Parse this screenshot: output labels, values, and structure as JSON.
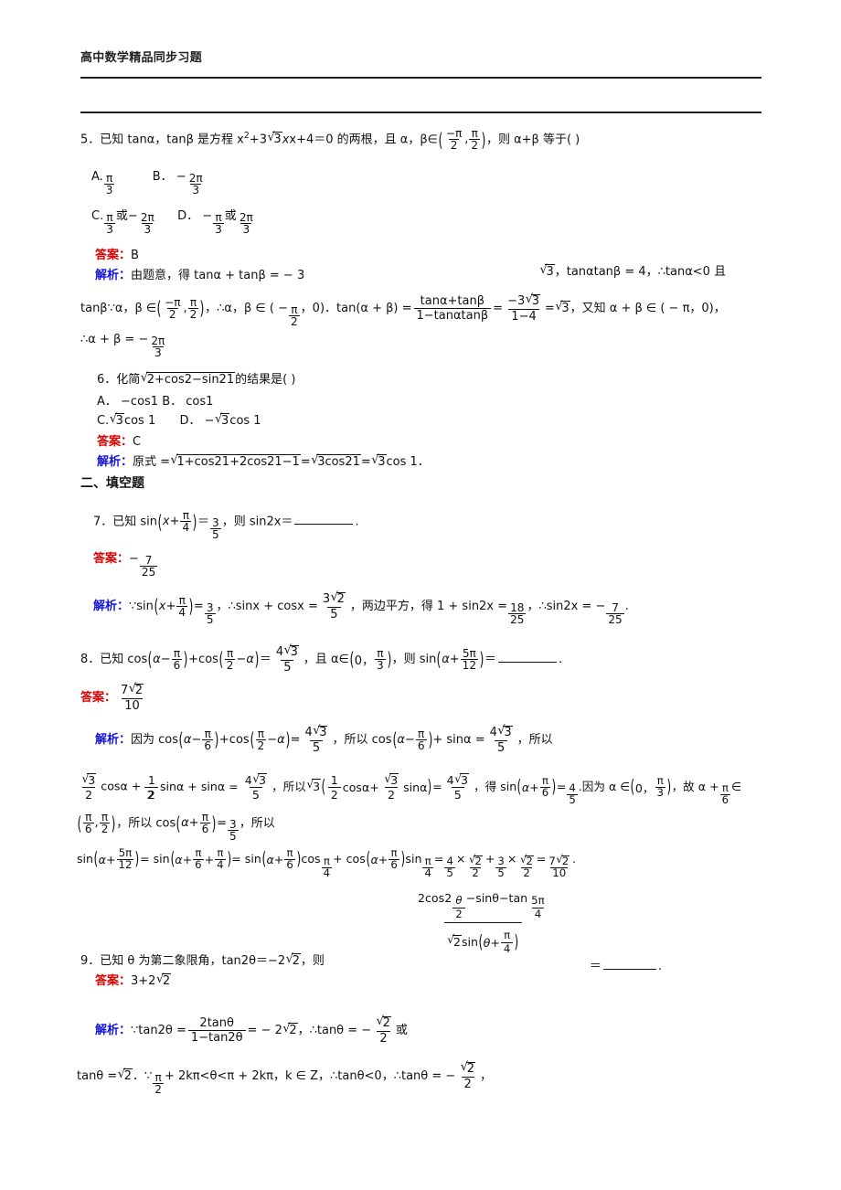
{
  "header": {
    "title": "高中数学精品同步习题"
  },
  "labels": {
    "answer": "答案：",
    "analysis": "解析："
  },
  "section": {
    "title": "二、填空题"
  },
  "q5": {
    "stem_a": "5．已知 tanα，tanβ 是方程 x",
    "stem_b": "+3",
    "stem_c": "x+4＝0 的两根，且 α，β∈",
    "stem_d": "，则 α+β 等于(      )",
    "exp": "2",
    "rad": "3",
    "interval_num": "−",
    "opt_a_label": "A.",
    "opt_b_label": "B． −",
    "opt_c_label": "C.",
    "opt_c_mid": "或−",
    "opt_d_label": "D． −",
    "opt_d_mid": "或",
    "pi": "π",
    "three": "3",
    "twopi": "2π",
    "two": "2",
    "answer": "B",
    "sol1": "由题意，得 tanα + tanβ = − 3",
    "sol1b": "，tanαtanβ = 4，∴tanα<0 且",
    "sol2a": "tanβ∵α，β ∈",
    "sol2b": "，∴α，β ∈ ( −",
    "sol2c": "，0)．tan(α + β) =",
    "sol2d": "=",
    "sol2e": "=",
    "sol2f": "，又知 α + β ∈ ( − π，0)，",
    "sol3": "∴α + β = −",
    "f_num1": "tanα+tanβ",
    "f_den1": "1−tanαtanβ",
    "f_num2": "−3",
    "f_den2": "1−4",
    "rad3": "3"
  },
  "q6": {
    "stem_a": "6．化简",
    "stem_rad": "2+cos2−sin21",
    "stem_b": "的结果是(      )",
    "opt_ab": "A． −cos1   B． cos1",
    "opt_c": "C.",
    "opt_c_t": "cos 1",
    "opt_d": "D． −",
    "opt_d_t": "cos 1",
    "rad3": "3",
    "answer": "C",
    "sol_a": "原式 =",
    "sol_rad1": "1+cos21+2cos21−1",
    "sol_eq1": "=",
    "sol_rad2": "3cos21",
    "sol_eq2": "=",
    "sol_rad3": "3",
    "sol_tail": "cos 1．"
  },
  "q7": {
    "stem_a": "7．已知 sin",
    "stem_inner": "x+",
    "stem_b": "＝",
    "stem_c": "，则 sin2x＝",
    "stem_d": ".",
    "pi": "π",
    "four": "4",
    "three": "3",
    "five": "5",
    "ans_sign": "−",
    "ans_num": "7",
    "ans_den": "25",
    "sol_a": "∵sin",
    "sol_b": "=",
    "sol_c": "，∴sinx + cosx =",
    "sol_d": "，两边平方，得 1 + sin2x =",
    "sol_e": "，∴sin2x = −",
    "sol_f": ".",
    "f32n": "3",
    "f32d": "5",
    "f18n": "18",
    "f18d": "25",
    "f7n": "7",
    "f7d": "25",
    "rad2": "2"
  },
  "q8": {
    "stem_a": "8．已知 cos",
    "in1": "α−",
    "stem_b": "+cos",
    "in2": "−α",
    "stem_c": "＝",
    "stem_d": "，且 α∈",
    "in3": "0，",
    "stem_e": "，则 sin",
    "in4": "α+",
    "stem_f": "＝",
    "stem_g": ".",
    "pi": "π",
    "six": "6",
    "two": "2",
    "three": "3",
    "four": "4",
    "five": "5",
    "fivepi": "5π",
    "twelve": "12",
    "ans_n": "7",
    "ans_rad": "2",
    "ans_d": "10",
    "sol1a": "因为 cos",
    "sol1b": "+cos",
    "sol1c": "=",
    "sol1d": "，所以 cos",
    "sol1e": "+ sinα =",
    "sol1f": "，所以",
    "sol2a": "cosα +",
    "sol2b": "sinα + sinα =",
    "sol2c": "，所以",
    "sol2d": "cosα+",
    "sol2e": "sinα",
    "sol2f": "=",
    "sol2g": "，得 sin",
    "sol2h": "=",
    "sol2i": ".因为 α ∈",
    "sol2j": "，故 α +",
    "sol2k": "∈",
    "sol3a": "，所以 cos",
    "sol3b": "=",
    "sol3c": "，所以",
    "sol4a": "sin",
    "sol4b": "= sin",
    "sol4c": "= sin",
    "sol4d": "cos",
    "sol4e": "+ cos",
    "sol4f": "sin",
    "sol4g": "=",
    "sol4h": "×",
    "sol4i": "+",
    "sol4j": "×",
    "sol4k": "=",
    "sol4l": ".",
    "in5": "α+",
    "in6": "α+",
    "in7": "+",
    "in8": "α+",
    "in9": "α+"
  },
  "q9": {
    "stem_a": "9．已知 θ 为第二象限角，tan2θ＝−2",
    "rad2": "2",
    "stem_b": "，则",
    "stem_c": "＝",
    "stem_d": ".",
    "frac_num_a": "2cos2",
    "frac_num_b": "−sinθ−tan",
    "frac_den_a": "sin",
    "theta": "θ",
    "two": "2",
    "fivepi": "5π",
    "four": "4",
    "pi": "π",
    "den_in": "θ+",
    "answer": "3+2",
    "ans_rad": "2",
    "sol1a": "∵tan2θ =",
    "sol1b": "= − 2",
    "sol1c": "，∴tanθ = −",
    "sol1d": "或",
    "sol2a": "tanθ =",
    "sol2b": "．∵",
    "sol2c": "+ 2kπ<θ<π + 2kπ，k ∈ Z，∴tanθ<0，∴tanθ = −",
    "sol2d": "，",
    "f2n": "2tanθ",
    "f2d": "1−tan2θ"
  }
}
